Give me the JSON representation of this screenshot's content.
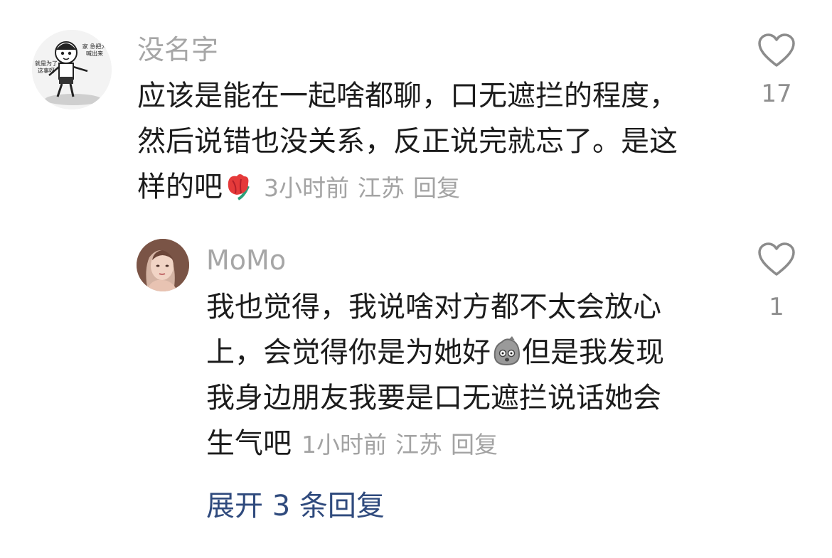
{
  "comment": {
    "username": "没名字",
    "avatar_text": "家喊出来·急把大·就是为了·这事呀",
    "lines": [
      "应该是能在一起啥都聊，口无遮拦的程度，",
      "然后说错也没关系，反正说完就忘了。是这",
      "样的吧"
    ],
    "emoji": "flower-emoji",
    "time": "3小时前",
    "location": "江苏",
    "reply_label": "回复",
    "likes": "17"
  },
  "reply": {
    "username": "MoMo",
    "lines": [
      "我也觉得，我说啥对方都不太会放心",
      "上，会觉得你是为她好",
      "但是我发现",
      "我身边朋友我要是口无遮拦说话她会",
      "生气吧"
    ],
    "emoji": "stone-face-emoji",
    "time": "1小时前",
    "location": "江苏",
    "reply_label": "回复",
    "likes": "1"
  },
  "expand_label": "展开 3 条回复",
  "colors": {
    "username": "#a6a6a6",
    "meta": "#a3a3a3",
    "link": "#2f4a7d"
  }
}
